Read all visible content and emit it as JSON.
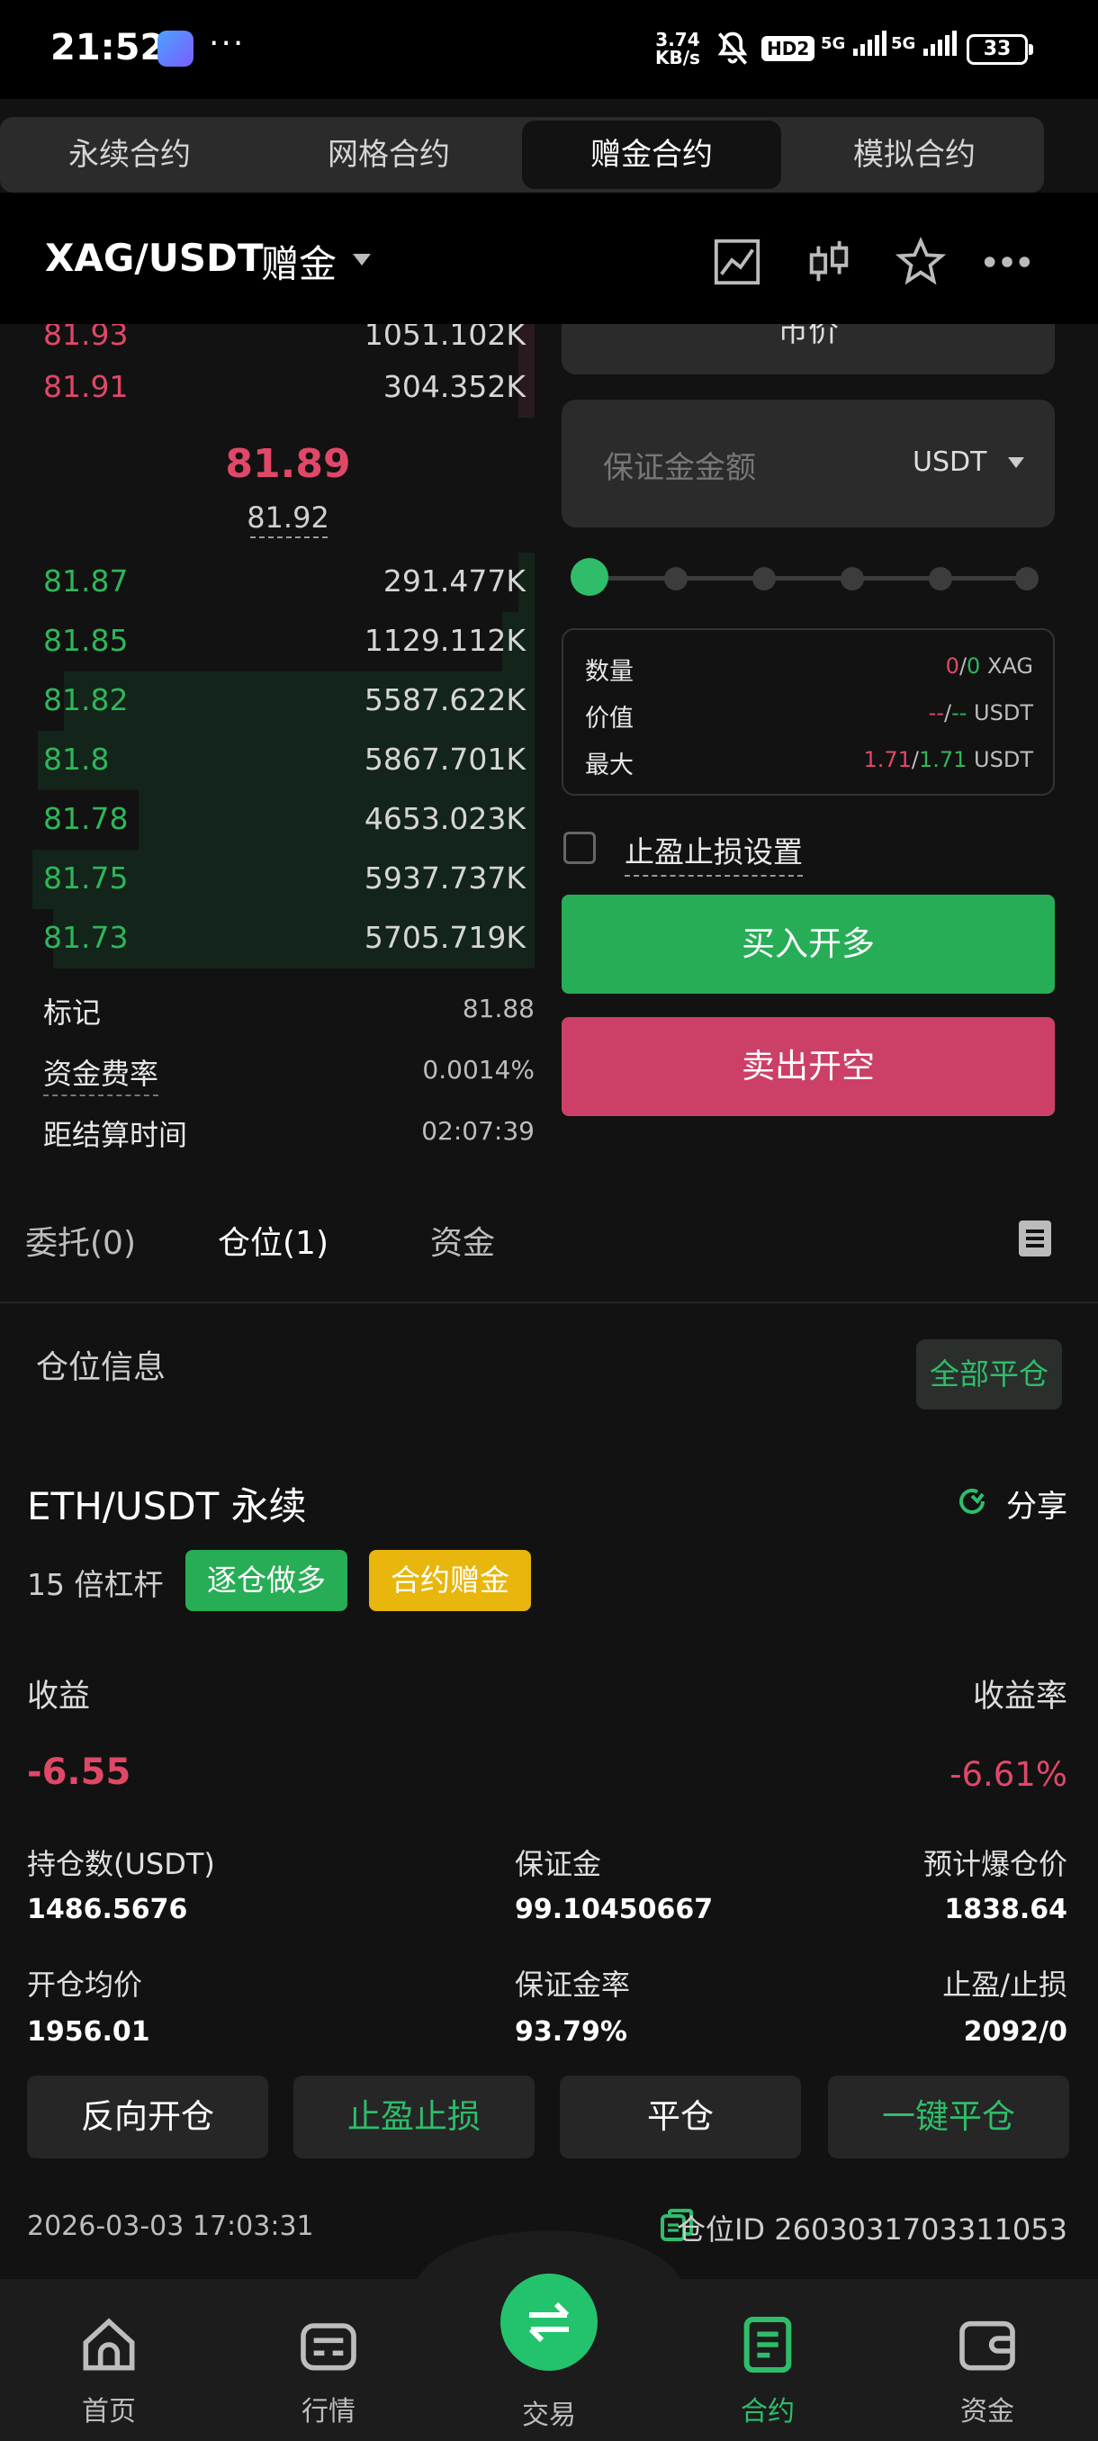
{
  "status_bar": {
    "time": "21:52",
    "more": "···",
    "net_speed_top": "3.74",
    "net_speed_bottom": "KB/s",
    "hd": "HD2",
    "signal1": "5G",
    "signal2": "5G",
    "battery": "33"
  },
  "top_tabs": [
    {
      "label": "永续合约",
      "active": false
    },
    {
      "label": "网格合约",
      "active": false
    },
    {
      "label": "赠金合约",
      "active": true
    },
    {
      "label": "模拟合约",
      "active": false
    }
  ],
  "header": {
    "pair": "XAG/USDT",
    "tag": "赠金",
    "icons": [
      "chart-line-icon",
      "candlestick-icon",
      "star-icon",
      "more-icon"
    ]
  },
  "orderbook": {
    "asks": [
      {
        "price": "81.93",
        "qty": "1051.102K",
        "depth": 0.03
      },
      {
        "price": "81.91",
        "qty": "304.352K",
        "depth": 0.03
      }
    ],
    "mid_price": "81.89",
    "mark_price": "81.92",
    "bids": [
      {
        "price": "81.87",
        "qty": "291.477K",
        "depth": 0.03
      },
      {
        "price": "81.85",
        "qty": "1129.112K",
        "depth": 0.06
      },
      {
        "price": "81.82",
        "qty": "5587.622K",
        "depth": 0.88
      },
      {
        "price": "81.8",
        "qty": "5867.701K",
        "depth": 0.93
      },
      {
        "price": "81.78",
        "qty": "4653.023K",
        "depth": 0.74
      },
      {
        "price": "81.75",
        "qty": "5937.737K",
        "depth": 0.94
      },
      {
        "price": "81.73",
        "qty": "5705.719K",
        "depth": 0.9
      }
    ],
    "info": [
      {
        "label": "标记",
        "value": "81.88"
      },
      {
        "label": "资金费率",
        "value": "0.0014%"
      },
      {
        "label": "距结算时间",
        "value": "02:07:39"
      }
    ]
  },
  "order_form": {
    "order_type": "市价",
    "margin_placeholder": "保证金金额",
    "margin_unit": "USDT",
    "slider_level": 0,
    "summary": {
      "qty_label": "数量",
      "qty_a": "0",
      "qty_sep": "/",
      "qty_b": "0",
      "qty_unit": "XAG",
      "value_label": "价值",
      "value_a": "--",
      "value_sep": "/",
      "value_b": "--",
      "value_unit": "USDT",
      "max_label": "最大",
      "max_a": "1.71",
      "max_sep": "/",
      "max_b": "1.71",
      "max_unit": "USDT"
    },
    "tpsl_label": "止盈止损设置",
    "buy_label": "买入开多",
    "sell_label": "卖出开空"
  },
  "section_tabs": {
    "orders": "委托(0)",
    "positions": "仓位(1)",
    "assets": "资金"
  },
  "position": {
    "section_title": "仓位信息",
    "close_all": "全部平仓",
    "symbol": "ETH/USDT 永续",
    "share": "分享",
    "leverage": "15 倍杠杆",
    "tag_mode": "逐仓做多",
    "tag_bonus": "合约赠金",
    "pnl_label": "收益",
    "pnl_value": "-6.55",
    "roi_label": "收益率",
    "roi_value": "-6.61%",
    "size_label": "持仓数(USDT)",
    "size_value": "1486.5676",
    "margin_label": "保证金",
    "margin_value": "99.10450667",
    "liq_label": "预计爆仓价",
    "liq_value": "1838.64",
    "entry_label": "开仓均价",
    "entry_value": "1956.01",
    "margin_ratio_label": "保证金率",
    "margin_ratio_value": "93.79%",
    "tpsl_label": "止盈/止损",
    "tpsl_value": "2092/0",
    "btn_reverse": "反向开仓",
    "btn_tpsl": "止盈止损",
    "btn_close": "平仓",
    "btn_quick_close": "一键平仓",
    "timestamp": "2026-03-03 17:03:31",
    "position_id": "仓位ID 2603031703311053"
  },
  "bottom_nav": [
    {
      "label": "首页",
      "icon": "home-icon"
    },
    {
      "label": "行情",
      "icon": "market-icon"
    },
    {
      "label": "交易",
      "icon": "swap-icon"
    },
    {
      "label": "合约",
      "icon": "contract-icon"
    },
    {
      "label": "资金",
      "icon": "wallet-icon"
    }
  ],
  "colors": {
    "green": "#2fb65a",
    "red": "#e04868",
    "accent": "#23c36e",
    "yellow": "#e8b60c"
  }
}
